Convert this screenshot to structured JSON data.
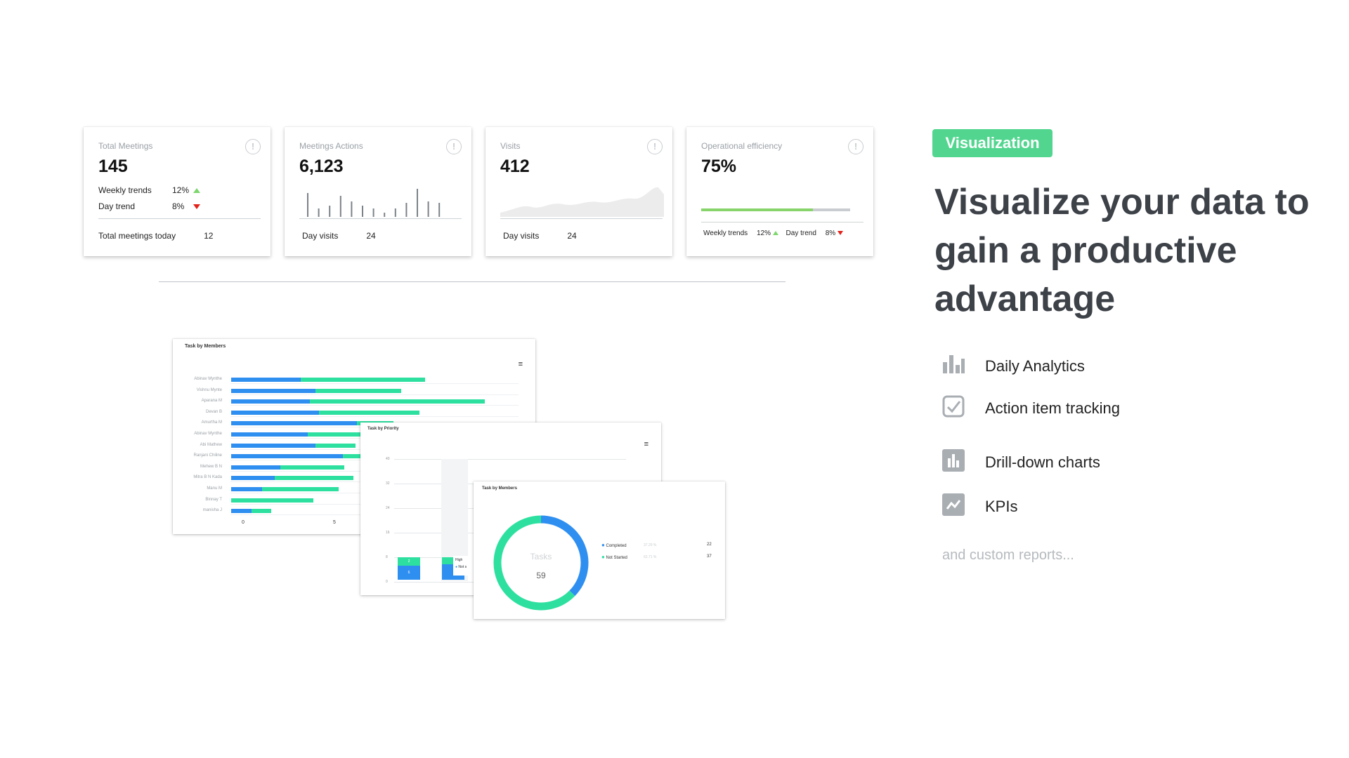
{
  "kpi_cards": [
    {
      "title": "Total Meetings",
      "value": "145",
      "trends": [
        {
          "label": "Weekly trends",
          "value": "12%",
          "dir": "up"
        },
        {
          "label": "Day trend",
          "value": "8%",
          "dir": "down"
        }
      ],
      "footer_label": "Total meetings  today",
      "footer_value": "12"
    },
    {
      "title": "Meetings Actions",
      "value": "6,123",
      "footer_label": "Day visits",
      "footer_value": "24",
      "spark": [
        0.85,
        0.3,
        0.4,
        0.75,
        0.55,
        0.4,
        0.3,
        0.15,
        0.3,
        0.5,
        1.0,
        0.55,
        0.5
      ]
    },
    {
      "title": "Visits",
      "value": "412",
      "footer_label": "Day visits",
      "footer_value": "24"
    },
    {
      "title": "Operational efficiency",
      "value": "75%",
      "progress": 0.75,
      "trends": [
        {
          "label": "Weekly trends",
          "value": "12%",
          "dir": "up"
        },
        {
          "label": "Day trend",
          "value": "8%",
          "dir": "down"
        }
      ]
    }
  ],
  "task_by_members": {
    "title": "Task by Members",
    "rows": [
      {
        "name": "Abinav Mynthe",
        "blue": 3.8,
        "green": 6.8
      },
      {
        "name": "Vishnu Mynte",
        "blue": 4.6,
        "green": 4.7
      },
      {
        "name": "Aparana M",
        "blue": 4.3,
        "green": 9.6
      },
      {
        "name": "Devan B",
        "blue": 4.8,
        "green": 5.5
      },
      {
        "name": "Amurtha M",
        "blue": 6.9,
        "green": 2.0
      },
      {
        "name": "Abinav Mynthe",
        "blue": 4.2,
        "green": 3.1
      },
      {
        "name": "Abi Mathew",
        "blue": 4.6,
        "green": 2.2
      },
      {
        "name": "Ranjani Chiline",
        "blue": 6.1,
        "green": 1.0
      },
      {
        "name": "Mehew B N",
        "blue": 2.7,
        "green": 3.5
      },
      {
        "name": "Mitra B N Kada",
        "blue": 2.4,
        "green": 4.3
      },
      {
        "name": "Manu M",
        "blue": 1.7,
        "green": 4.2
      },
      {
        "name": "Binnay T",
        "blue": 0,
        "green": 4.5
      },
      {
        "name": "manisha J",
        "blue": 1.1,
        "green": 1.1
      }
    ],
    "x_ticks": [
      "0",
      "5"
    ]
  },
  "task_by_priority": {
    "title": "Task by Priority",
    "y_ticks": [
      "40",
      "32",
      "24",
      "16",
      "8",
      "0"
    ],
    "bars": [
      {
        "green": "2",
        "blue": "6"
      }
    ],
    "tooltip": [
      "High",
      "Not s"
    ]
  },
  "task_donut": {
    "title": "Task by Members",
    "center_label": "Tasks",
    "center_value": "59",
    "legend": [
      {
        "label": "Completed",
        "pct": "37.29 %",
        "value": "22",
        "color": "#2f8ff0"
      },
      {
        "label": "Not Started",
        "pct": "62.71 %",
        "value": "37",
        "color": "#2de0a0"
      }
    ]
  },
  "right": {
    "badge": "Visualization",
    "headline": "Visualize your data to gain a productive advantage",
    "features": [
      {
        "label": "Daily Analytics",
        "icon": "bar-chart-icon"
      },
      {
        "label": "Action item tracking",
        "icon": "checkbox-icon"
      },
      {
        "label": "Drill-down charts",
        "icon": "column-chart-icon"
      },
      {
        "label": "KPIs",
        "icon": "trend-line-icon"
      }
    ],
    "more": "and custom reports..."
  },
  "colors": {
    "accent": "#52d68f",
    "blue": "#2f8ff0",
    "green": "#2de0a0",
    "up": "#7ed66e",
    "down": "#e2231a"
  }
}
